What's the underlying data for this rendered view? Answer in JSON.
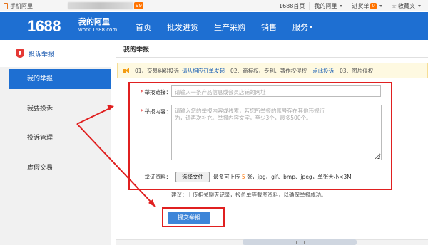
{
  "topbar": {
    "mobile_label": "手机阿里",
    "user_badge": "99",
    "links": [
      {
        "label": "1688首页",
        "caret": false
      },
      {
        "label": "我的阿里",
        "caret": true
      },
      {
        "label": "进货单",
        "count": "0",
        "caret": true
      },
      {
        "label": "收藏夹",
        "caret": true
      }
    ]
  },
  "header": {
    "logo": "1688",
    "mysite_title": "我的阿里",
    "mysite_url": "work.1688.com",
    "nav": [
      {
        "label": "首页"
      },
      {
        "label": "批发进货"
      },
      {
        "label": "生产采购"
      },
      {
        "label": "销售"
      },
      {
        "label": "服务"
      }
    ]
  },
  "sidebar": {
    "title": "投诉举报",
    "items": [
      {
        "label": "我的举报",
        "active": true
      },
      {
        "label": "我要投诉",
        "active": false
      },
      {
        "label": "投诉管理",
        "active": false
      },
      {
        "label": "虚假交易",
        "active": false
      }
    ]
  },
  "main": {
    "title": "我的举报",
    "notice": {
      "item1": "01、交易纠纷投诉",
      "link1": "请从相应订单发起",
      "item2": "02、商标权、专利、著作权侵权",
      "link2": "点此投诉",
      "item3": "03、图片侵权"
    },
    "form": {
      "link_label": "举报链接：",
      "link_placeholder": "请输入一条产品信息或会员店铺的网址",
      "content_label": "举报内容：",
      "content_placeholder_1": "请输入您的举报内容或线索，若您所举报的账号存在其他违规行",
      "content_placeholder_2": "为，请再次补充。举报内容文字，至少3个，最多500个。",
      "evidence_label": "举证资料：",
      "file_button": "选择文件",
      "file_hint_pre": "最多可上传 ",
      "file_hint_num": "5",
      "file_hint_post": " 张，jpg、gif、bmp、jpeg，单张大小<3M",
      "tip": "建议：上传相关聊天记录，报价单等截图资料，以确保举报成功。",
      "submit": "提交举报"
    }
  },
  "colors": {
    "brand_blue": "#1e6fd2",
    "highlight_red": "#e02020",
    "accent_orange": "#ff7300"
  }
}
